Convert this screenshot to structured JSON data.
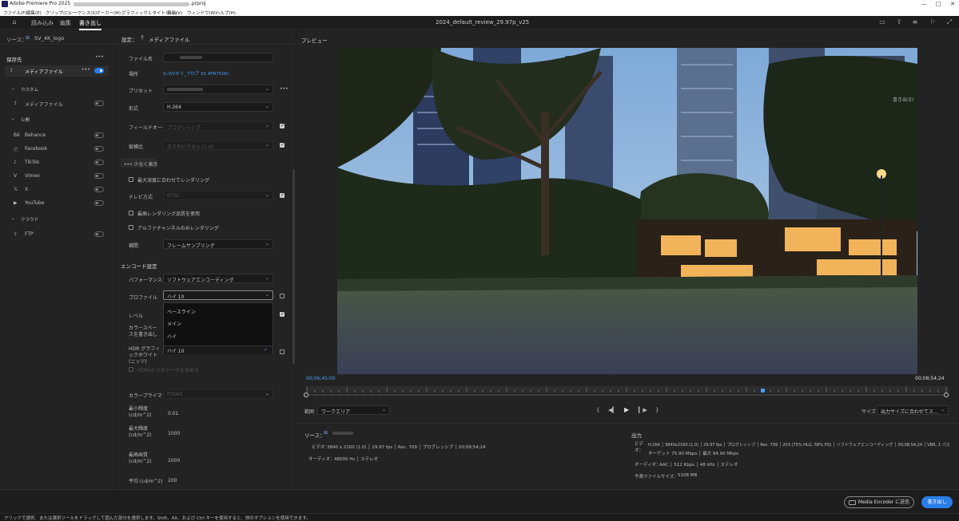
{
  "window": {
    "app_title": "Adobe Premiere Pro 2025",
    "project_suffix": ".prproj",
    "minimize": "—",
    "maximize": "□",
    "close": "✕"
  },
  "menu": [
    "ファイル(F)",
    "編集(E)",
    "クリップ(C)",
    "シーケンス(S)",
    "マーカー(M)",
    "グラフィックとタイトル(G)",
    "表示(V)",
    "ウィンドウ(W)",
    "ヘルプ(H)"
  ],
  "header": {
    "tabs": [
      "読み込み",
      "編集",
      "書き出し"
    ],
    "active_tab": "書き出し",
    "sequence_title": "2024_default_review_29.97p_v25"
  },
  "source_bar": {
    "label": "ソース：",
    "source_name": "SV_4K_logo"
  },
  "left": {
    "section_title": "保存先",
    "more": "•••",
    "media_file": "メディアファイル",
    "custom_header": "カスタム",
    "custom_item": "メディアファイル",
    "public_header": "公開",
    "public_items": [
      "Behance",
      "Facebook",
      "TikTok",
      "Vimeo",
      "X",
      "YouTube"
    ],
    "cloud_header": "クラウド",
    "cloud_items": [
      "FTP"
    ]
  },
  "settings": {
    "title": "設定：",
    "target": "メディアファイル",
    "filename_label": "ファイル名",
    "location_label": "場所",
    "location_value": "G:\\SVオリ_プロア 01 ATR7500\\",
    "preset_label": "プリセット",
    "preset_more": "•••",
    "format_label": "形式",
    "format_value": "H.264",
    "field_order_label": "フィールドオーダー",
    "field_order_value": "プログレッシブ",
    "aspect_label": "縦横比",
    "aspect_value": "正方形ピクセル (1.0)",
    "less_button": "••• 少なく表示",
    "max_depth": "最大深度に合わせてレンダリング",
    "tv_standard_label": "テレビ方式",
    "tv_standard_value": "NTSC",
    "max_quality": "最高レンダリング品質を使用",
    "alpha_only": "アルファチャンネルのみレンダリング",
    "interp_label": "補間",
    "interp_value": "フレームサンプリング",
    "encode_title": "エンコード設定",
    "performance_label": "パフォーマンス",
    "performance_value": "ソフトウェアエンコーディング",
    "profile_label": "プロファイル",
    "profile_value": "ハイ 10",
    "level_label": "レベル",
    "colorspace_label": "カラースペースを書き出し",
    "hdr_label": "HDR グラフィックホワイト (ニッツ)",
    "hdr_meta": "HDR10 メタデータを含める",
    "primaries_label": "カラープライマリ",
    "primaries_value": "P3D65",
    "min_lum_label": "最小輝度 (cd/m^2)",
    "min_lum_value": "0.01",
    "max_lum_label": "最大輝度 (cd/m^2)",
    "max_lum_value": "1000",
    "max_content_label": "最高画質 (cd/m^2)",
    "max_content_value": "1000",
    "avg_label": "平均 (cd/m^2)",
    "avg_value": "200",
    "profile_options": [
      "ベースライン",
      "メイン",
      "ハイ",
      "ハイ 10"
    ],
    "profile_checkmark": "✓"
  },
  "preview": {
    "title": "プレビュー",
    "timecode_in": "00;06;45;00",
    "timecode_out": "00;08;54;24",
    "range_label": "範囲",
    "range_value": "ワークエリア",
    "size_label": "サイズ",
    "size_value": "出力サイズに合わせてス…",
    "overlay_label": "書き出(E)",
    "progress": 0.71,
    "playhead": 0.52
  },
  "source_info": {
    "title": "ソース：",
    "video_label": "ビデオ：",
    "video_value": "3840 x 2160 (1.0) │ 29.97 fps │ Rec. 709 │ プログレッシブ │ 00;08;54;24",
    "audio_label": "オーディオ：",
    "audio_value": "48000 Hz │ ステレオ"
  },
  "output_info": {
    "title": "出力",
    "video_label": "ビデ\nオ：",
    "video_line1": "H.264 │ 3840x2160 (1.0) │ 29.97 fps │ プログレッシブ │ Rec. 709 │ 203 (75% HLG, 58% PQ) │ ソフトウェアエンコーディング │ 00;08;54;24 │ VBR, 1 パス",
    "video_line2": "ターゲット 75.90 Mbps │ 最大 94.90 Mbps",
    "audio_label": "オーディオ：",
    "audio_value": "AAC │ 512 Kbps │ 48 kHz │ ステレオ",
    "size_label": "予測ファイルサイズ：",
    "size_value": "5108 MB"
  },
  "footer": {
    "send_to_me": "Media Encoder に送信",
    "export": "書き出し"
  },
  "status": "クリックで選択、または選択ツールをドラッグして囲んだ部分を選択します。Shift、Alt、および Ctrl キーを使用すると、他のオプションを使用できます。",
  "colors": {
    "accent": "#2b7de9",
    "bg": "#232323"
  }
}
